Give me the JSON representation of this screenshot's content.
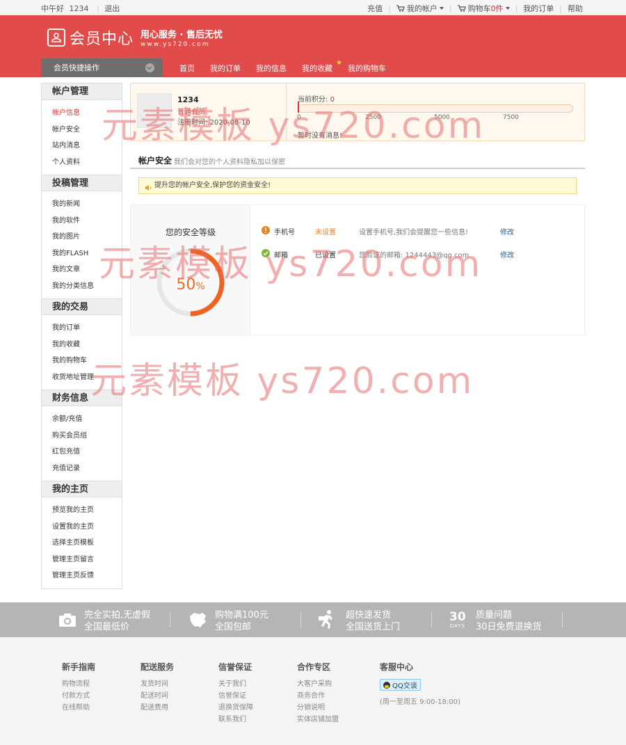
{
  "topbar": {
    "greeting": "中午好",
    "username": "1234",
    "logout": "退出",
    "recharge": "充值",
    "my_account": "我的帐户",
    "cart_label": "购物车",
    "cart_count": "0件",
    "my_orders": "我的订单",
    "help": "帮助"
  },
  "header": {
    "title": "会员中心",
    "slogan": "用心服务 · 售后无忧",
    "domain": "www.ys720.com",
    "quick_ops": "会员快捷操作",
    "nav": [
      "首页",
      "我的订单",
      "我的信息",
      "我的收藏",
      "我的购物车"
    ]
  },
  "sidebar": [
    {
      "title": "帐户管理",
      "items": [
        "帐户信息",
        "帐户安全",
        "站内消息",
        "个人资料"
      ]
    },
    {
      "title": "投稿管理",
      "items": [
        "我的新闻",
        "我的软件",
        "我的图片",
        "我的FLASH",
        "我的文章",
        "我的分类信息"
      ]
    },
    {
      "title": "我的交易",
      "items": [
        "我的订单",
        "我的收藏",
        "我的购物车",
        "收货地址管理"
      ]
    },
    {
      "title": "财务信息",
      "items": [
        "余额/充值",
        "购买会员组",
        "红包充值",
        "充值记录"
      ]
    },
    {
      "title": "我的主页",
      "items": [
        "预览我的主页",
        "设置我的主页",
        "选择主页模板",
        "管理主页留言",
        "管理主页反馈"
      ]
    }
  ],
  "profile": {
    "username": "1234",
    "level": "普通会员",
    "reg_label": "注册时间:",
    "reg_date": "2020-08-10",
    "points_label": "当前积分:",
    "points": "0",
    "points_value": 0,
    "ticks": [
      "0",
      "2500",
      "5000",
      "7500"
    ],
    "no_message": "暂时没有消息!"
  },
  "security": {
    "title": "帐户安全",
    "desc": "我们会对您的个人资料隐私加以保密",
    "notice": "提升您的帐户安全,保护您的资金安全!",
    "level_label": "您的安全等级",
    "percent_value": 50,
    "percent_num": "50",
    "percent_sign": "%",
    "rows": [
      {
        "label": "手机号",
        "status": "未设置",
        "desc": "设置手机号,我们会提醒您一些信息!",
        "action": "修改",
        "status_color": "#e4832a",
        "icon_color": "#e4832a"
      },
      {
        "label": "邮箱",
        "status": "已设置",
        "desc": "您验证的邮箱: 1244443@qq.com",
        "action": "修改",
        "status_color": "#333333",
        "icon_color": "#7bb832"
      }
    ]
  },
  "watermark": "元素模板 ys720.com",
  "band": [
    {
      "l1": "完全实拍,无虚假",
      "l2": "全国最低价"
    },
    {
      "l1": "购物满100元",
      "l2": "全国包邮"
    },
    {
      "l1": "超快速发货",
      "l2": "全国送货上门"
    },
    {
      "l1": "质量问题",
      "l2": "30日免费退换货"
    }
  ],
  "band_days": {
    "num": "30",
    "word": "DAYS"
  },
  "footer": {
    "cols": [
      {
        "title": "新手指南",
        "links": [
          "购物流程",
          "付款方式",
          "在线帮助"
        ]
      },
      {
        "title": "配送服务",
        "links": [
          "发货时间",
          "配送时间",
          "配送费用"
        ]
      },
      {
        "title": "信誉保证",
        "links": [
          "关于我们",
          "信誉保证",
          "退换货保障",
          "联系我们"
        ]
      },
      {
        "title": "合作专区",
        "links": [
          "大客户采购",
          "商务合作",
          "分销说明",
          "实体店铺加盟"
        ]
      }
    ],
    "service_title": "客服中心",
    "qq_label": "QQ交谈",
    "hours": "(周一至周五 9:00-18:00)"
  },
  "colors": {
    "brand": "#e14b49",
    "accent": "#d9342f",
    "gauge": "#f0621f"
  }
}
